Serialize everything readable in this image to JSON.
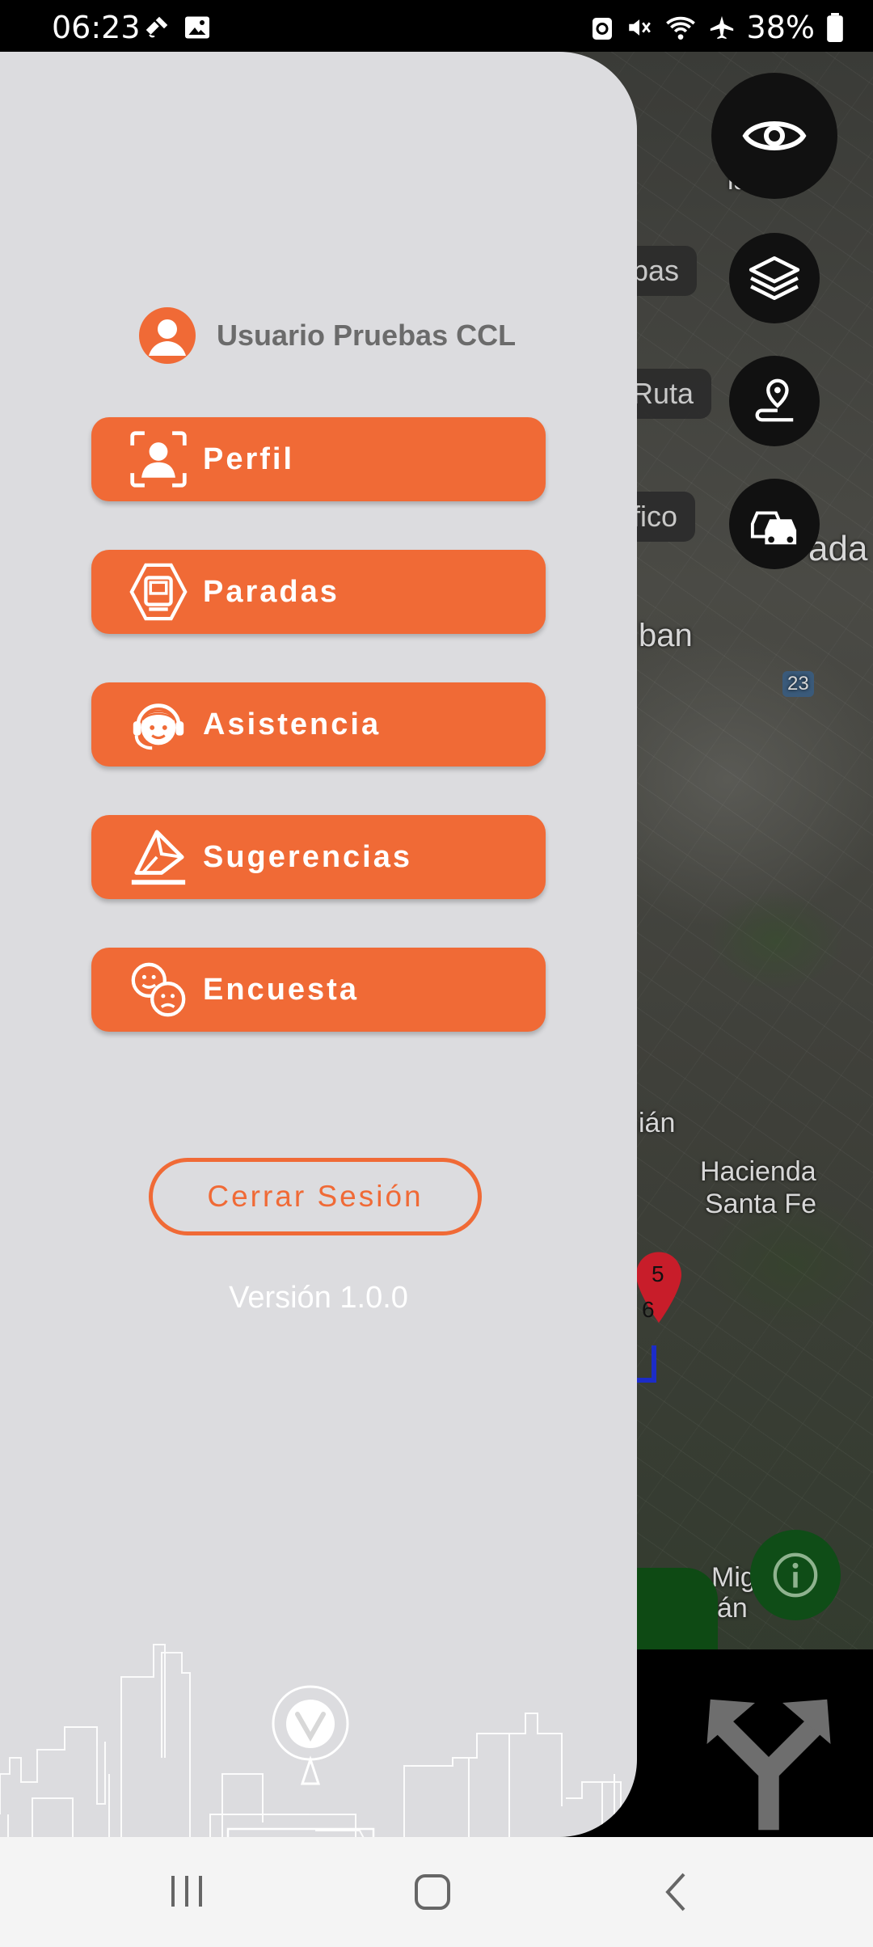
{
  "status_bar": {
    "time": "06:23",
    "battery_percent": "38%",
    "icons_left": [
      "satellite-icon",
      "image-icon"
    ],
    "icons_right": [
      "recycle-icon",
      "mute-icon",
      "wifi-icon",
      "airplane-icon",
      "battery-icon"
    ]
  },
  "map": {
    "chips": [
      "pas",
      "Ruta",
      "fico"
    ],
    "labels": [
      "ladas",
      "ada",
      "ban",
      "23",
      "ián",
      "Hacienda",
      "Santa Fe",
      "Migu",
      "tlán",
      "5",
      "6"
    ],
    "fabs": [
      "eye-icon",
      "layers-icon",
      "route-icon",
      "traffic-icon"
    ]
  },
  "drawer": {
    "user_name": "Usuario Pruebas CCL",
    "menu": [
      {
        "label": "Perfil",
        "icon": "profile-icon"
      },
      {
        "label": "Paradas",
        "icon": "bus-stop-icon"
      },
      {
        "label": "Asistencia",
        "icon": "support-agent-icon"
      },
      {
        "label": "Sugerencias",
        "icon": "suggestion-envelope-icon"
      },
      {
        "label": "Encuesta",
        "icon": "survey-faces-icon"
      }
    ],
    "logout_label": "Cerrar Sesión",
    "version": "Versión 1.0.0"
  },
  "colors": {
    "accent": "#f06a36",
    "drawer_bg": "#dcdcdf",
    "text_gray": "#6b6b6b"
  }
}
